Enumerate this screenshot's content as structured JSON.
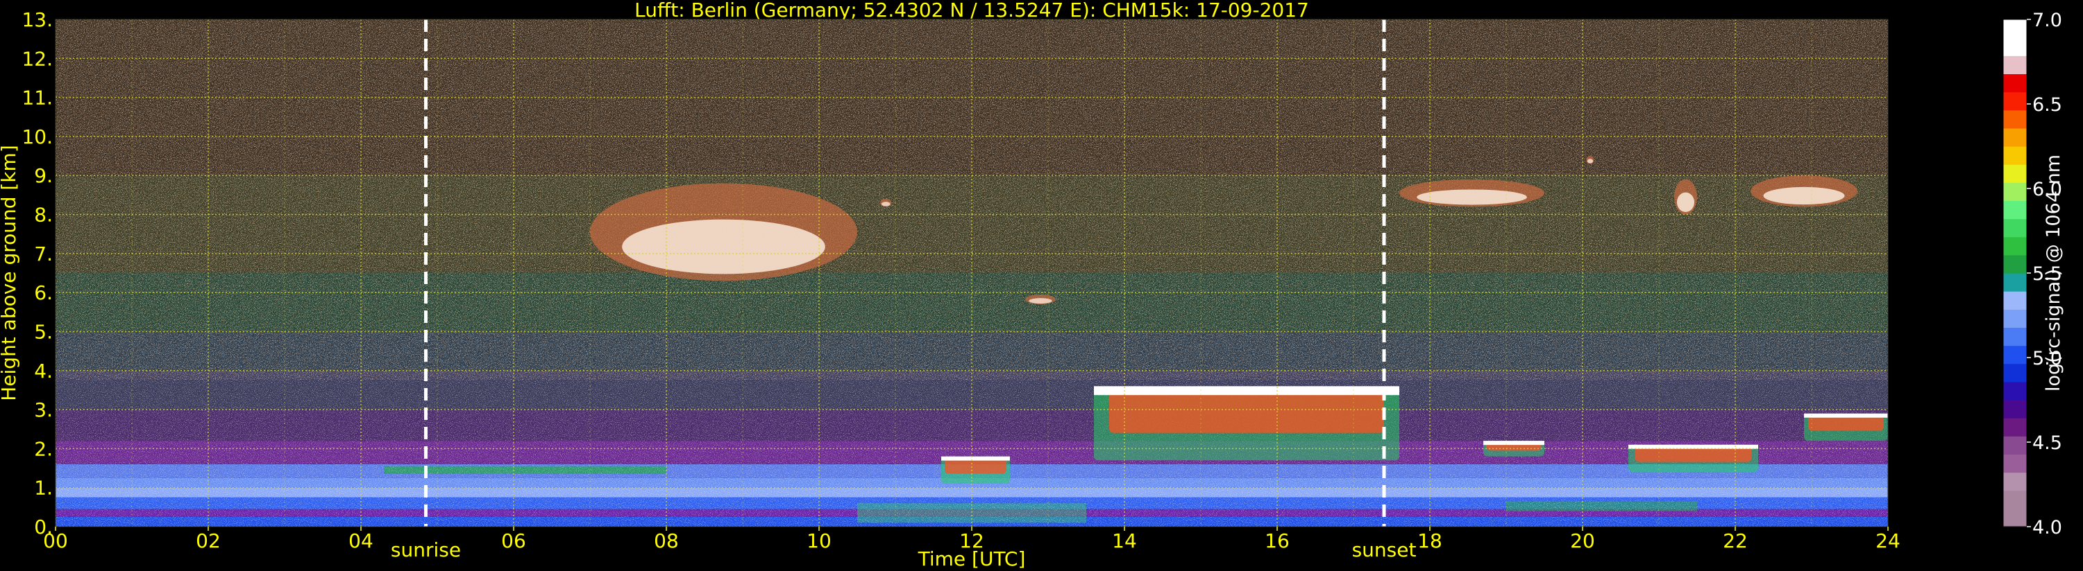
{
  "chart_data": {
    "type": "heatmap",
    "title": "Lufft: Berlin (Germany; 52.4302 N / 13.5247 E):    CHM15k: 17-09-2017",
    "xlabel": "Time [UTC]",
    "ylabel": "Height above ground [km]",
    "xlim": [
      0,
      24
    ],
    "ylim": [
      0,
      13
    ],
    "x_ticks": [
      0,
      2,
      4,
      6,
      8,
      10,
      12,
      14,
      16,
      18,
      20,
      22,
      24
    ],
    "x_tick_labels": [
      "00",
      "02",
      "04",
      "06",
      "08",
      "10",
      "12",
      "14",
      "16",
      "18",
      "20",
      "22",
      "24"
    ],
    "y_ticks": [
      0,
      1,
      2,
      3,
      4,
      5,
      6,
      7,
      8,
      9,
      10,
      11,
      12,
      13
    ],
    "y_tick_labels": [
      "0.",
      "1.",
      "2.",
      "3.",
      "4.",
      "5.",
      "6.",
      "7.",
      "8.",
      "9.",
      "10.",
      "11.",
      "12.",
      "13."
    ],
    "grid": true,
    "markers": [
      {
        "label": "sunrise",
        "x": 4.85
      },
      {
        "label": "sunset",
        "x": 17.4
      }
    ],
    "colorbar": {
      "label": "log(rc-signal) @ 1064 nm",
      "range": [
        4.0,
        7.0
      ],
      "ticks": [
        4.0,
        4.5,
        5.0,
        5.5,
        6.0,
        6.5,
        7.0
      ],
      "tick_labels": [
        "4.0",
        "4.5",
        "5.0",
        "5.5",
        "6.0",
        "6.5",
        "7.0"
      ],
      "colors": [
        "#a8869e",
        "#a8869e",
        "#b491ad",
        "#9a5f9a",
        "#8a4a92",
        "#6a1a80",
        "#4a0a90",
        "#2a10b0",
        "#1030d8",
        "#2050ee",
        "#4c7cf5",
        "#7aa0f8",
        "#9cb8fa",
        "#1aa0a0",
        "#20a040",
        "#30c040",
        "#40d860",
        "#60f080",
        "#a0f060",
        "#e8f020",
        "#f8c800",
        "#f8a000",
        "#f86000",
        "#f82000",
        "#e80000",
        "#e8c0c8",
        "#ffffff",
        "#ffffff"
      ]
    },
    "features": [
      {
        "kind": "boundary_layer",
        "x": [
          0,
          24
        ],
        "y": [
          0,
          1.6
        ]
      },
      {
        "kind": "residual_layer",
        "x": [
          0,
          24
        ],
        "y": [
          1.6,
          2.2
        ]
      },
      {
        "kind": "cirrus",
        "x": [
          7.0,
          10.5
        ],
        "y": [
          6.3,
          8.8
        ]
      },
      {
        "kind": "cloud",
        "x": [
          10.8,
          10.95
        ],
        "y": [
          8.2,
          8.4
        ]
      },
      {
        "kind": "cloud",
        "x": [
          12.7,
          13.1
        ],
        "y": [
          5.7,
          5.95
        ]
      },
      {
        "kind": "cirrus",
        "x": [
          17.6,
          19.5
        ],
        "y": [
          8.2,
          8.9
        ]
      },
      {
        "kind": "cirrus",
        "x": [
          21.2,
          21.5
        ],
        "y": [
          8.0,
          8.9
        ]
      },
      {
        "kind": "cirrus",
        "x": [
          22.2,
          23.6
        ],
        "y": [
          8.2,
          9.0
        ]
      },
      {
        "kind": "cloud",
        "x": [
          20.05,
          20.15
        ],
        "y": [
          9.3,
          9.5
        ]
      },
      {
        "kind": "cloud_base",
        "x": [
          11.6,
          12.5
        ],
        "y": [
          1.1,
          1.8
        ]
      },
      {
        "kind": "cloud_base",
        "x": [
          13.6,
          17.6
        ],
        "y": [
          1.7,
          3.6
        ]
      },
      {
        "kind": "cloud_base",
        "x": [
          18.7,
          19.5
        ],
        "y": [
          1.8,
          2.2
        ]
      },
      {
        "kind": "cloud_base",
        "x": [
          20.6,
          22.3
        ],
        "y": [
          1.4,
          2.1
        ]
      },
      {
        "kind": "cloud_base",
        "x": [
          22.9,
          24
        ],
        "y": [
          2.2,
          2.9
        ]
      }
    ]
  }
}
